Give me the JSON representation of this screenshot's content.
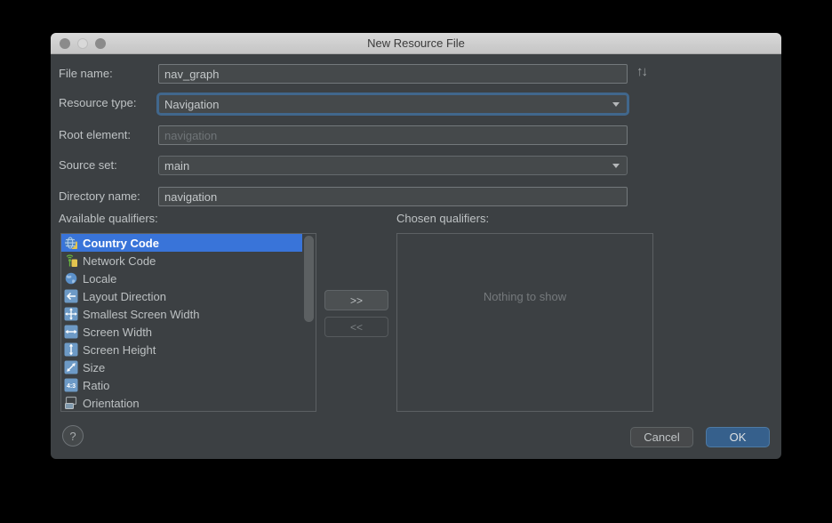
{
  "window": {
    "title": "New Resource File"
  },
  "form": {
    "file_name": {
      "label": "File name:",
      "value": "nav_graph"
    },
    "resource_type": {
      "label": "Resource type:",
      "value": "Navigation"
    },
    "root_element": {
      "label": "Root element:",
      "value": "",
      "placeholder": "navigation"
    },
    "source_set": {
      "label": "Source set:",
      "value": "main"
    },
    "directory_name": {
      "label": "Directory name:",
      "value": "navigation"
    }
  },
  "qualifiers": {
    "available_label": "Available qualifiers:",
    "chosen_label": "Chosen qualifiers:",
    "available": [
      {
        "label": "Country Code",
        "icon": "country-code-icon",
        "selected": true
      },
      {
        "label": "Network Code",
        "icon": "network-code-icon",
        "selected": false
      },
      {
        "label": "Locale",
        "icon": "locale-icon",
        "selected": false
      },
      {
        "label": "Layout Direction",
        "icon": "layout-direction-icon",
        "selected": false
      },
      {
        "label": "Smallest Screen Width",
        "icon": "smallest-screen-width-icon",
        "selected": false
      },
      {
        "label": "Screen Width",
        "icon": "screen-width-icon",
        "selected": false
      },
      {
        "label": "Screen Height",
        "icon": "screen-height-icon",
        "selected": false
      },
      {
        "label": "Size",
        "icon": "size-icon",
        "selected": false
      },
      {
        "label": "Ratio",
        "icon": "ratio-icon",
        "selected": false
      },
      {
        "label": "Orientation",
        "icon": "orientation-icon",
        "selected": false
      }
    ],
    "ratio_icon_text": "4:3",
    "chosen_empty_text": "Nothing to show",
    "move_right_label": ">>",
    "move_left_label": "<<"
  },
  "footer": {
    "help_label": "?",
    "cancel_label": "Cancel",
    "ok_label": "OK"
  },
  "colors": {
    "selection_blue": "#3974d9",
    "ok_button_blue": "#36608c",
    "focus_ring_blue": "#41678c",
    "dialog_background": "#3c4043",
    "titlebar_gray": "#cfcfcf"
  }
}
